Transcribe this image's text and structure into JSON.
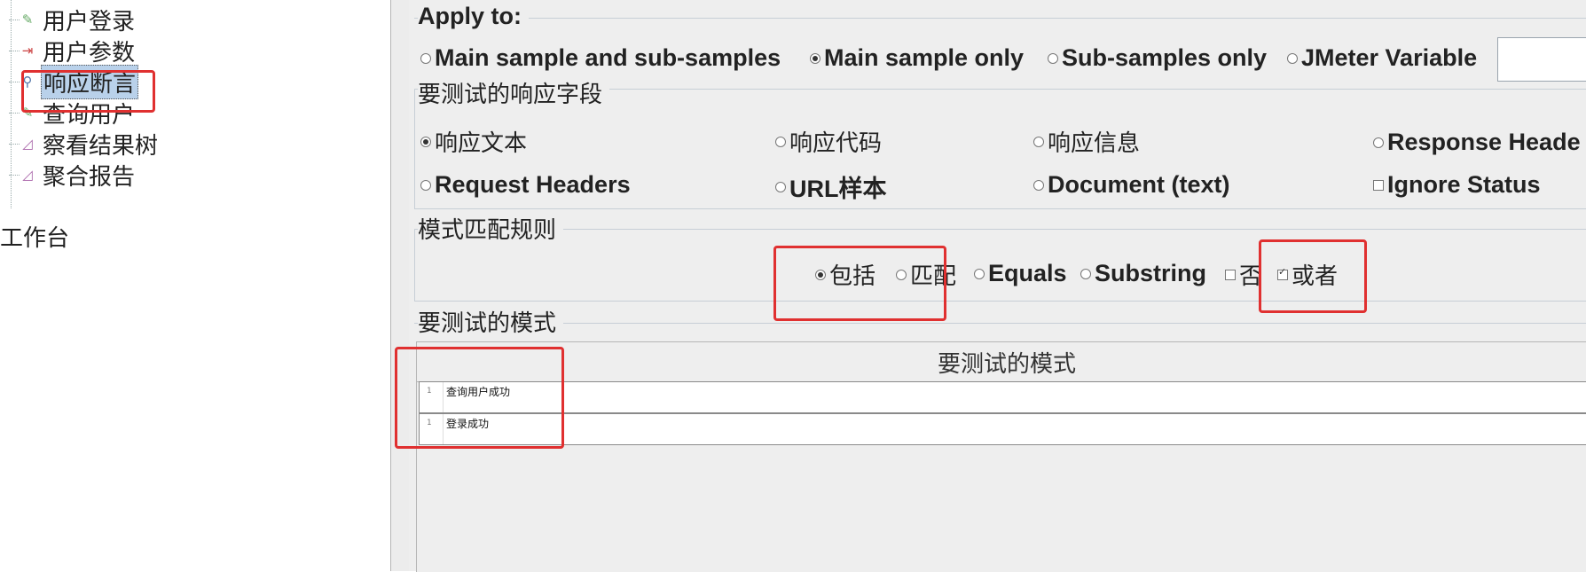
{
  "tree": {
    "items": [
      {
        "label": "用户登录",
        "icon": "pencil-icon"
      },
      {
        "label": "用户参数",
        "icon": "params-icon"
      },
      {
        "label": "响应断言",
        "icon": "magnifier-icon",
        "selected": true
      },
      {
        "label": "查询用户",
        "icon": "pencil-icon"
      },
      {
        "label": "察看结果树",
        "icon": "chart-icon"
      },
      {
        "label": "聚合报告",
        "icon": "chart-icon"
      }
    ],
    "workbench": "工作台"
  },
  "apply_to": {
    "title": "Apply to:",
    "options": [
      "Main sample and sub-samples",
      "Main sample only",
      "Sub-samples only",
      "JMeter Variable"
    ],
    "selected": "Main sample only",
    "variable_value": ""
  },
  "response_field": {
    "title": "要测试的响应字段",
    "row1": [
      "响应文本",
      "响应代码",
      "响应信息",
      "Response Heade"
    ],
    "row2": [
      "Request Headers",
      "URL样本",
      "Document (text)",
      "Ignore Status"
    ],
    "selected": "响应文本",
    "ignore_status_checked": false
  },
  "pattern_rules": {
    "title": "模式匹配规则",
    "options": [
      "包括",
      "匹配",
      "Equals",
      "Substring"
    ],
    "selected": "包括",
    "negate_label": "否",
    "negate_checked": false,
    "or_label": "或者",
    "or_checked": true
  },
  "patterns": {
    "title": "要测试的模式",
    "column_header": "要测试的模式",
    "rows": [
      {
        "line": "1",
        "value": "查询用户成功"
      },
      {
        "line": "1",
        "value": "登录成功"
      }
    ]
  },
  "colors": {
    "annotation": "#e03030",
    "selection": "#b9d1ea",
    "panel": "#eeeeee"
  }
}
